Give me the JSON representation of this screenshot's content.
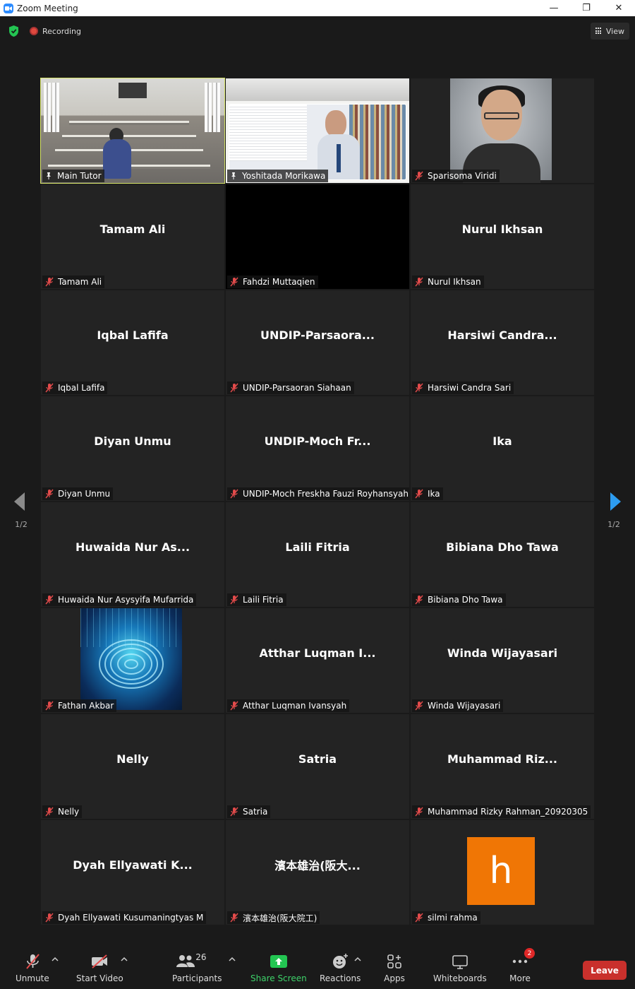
{
  "window": {
    "title": "Zoom Meeting",
    "controls": [
      "—",
      "❐",
      "✕"
    ]
  },
  "topbar": {
    "recording_label": "Recording",
    "view_label": "View"
  },
  "gallery": {
    "page_indicator_left": "1/2",
    "page_indicator_right": "1/2",
    "tiles": [
      {
        "label": "Main Tutor",
        "center": ""
      },
      {
        "label": "Yoshitada Morikawa",
        "center": ""
      },
      {
        "label": "Sparisoma Viridi",
        "center": ""
      },
      {
        "label": "Tamam Ali",
        "center": "Tamam Ali"
      },
      {
        "label": "Fahdzi Muttaqien",
        "center": ""
      },
      {
        "label": "Nurul Ikhsan",
        "center": "Nurul Ikhsan"
      },
      {
        "label": "Iqbal Lafifa",
        "center": "Iqbal Lafifa"
      },
      {
        "label": "UNDIP-Parsaoran Siahaan",
        "center": "UNDIP-Parsaora..."
      },
      {
        "label": "Harsiwi Candra Sari",
        "center": "Harsiwi Candra..."
      },
      {
        "label": "Diyan Unmu",
        "center": "Diyan Unmu"
      },
      {
        "label": "UNDIP-Moch Freskha Fauzi Royhansyah",
        "center": "UNDIP-Moch Fr..."
      },
      {
        "label": "Ika",
        "center": "Ika"
      },
      {
        "label": "Huwaida Nur Asysyifa Mufarrida",
        "center": "Huwaida Nur As..."
      },
      {
        "label": "Laili Fitria",
        "center": "Laili Fitria"
      },
      {
        "label": "Bibiana Dho Tawa",
        "center": "Bibiana Dho Tawa"
      },
      {
        "label": "Fathan Akbar",
        "center": ""
      },
      {
        "label": "Atthar Luqman Ivansyah",
        "center": "Atthar Luqman I..."
      },
      {
        "label": "Winda Wijayasari",
        "center": "Winda Wijayasari"
      },
      {
        "label": "Nelly",
        "center": "Nelly"
      },
      {
        "label": "Satria",
        "center": "Satria"
      },
      {
        "label": "Muhammad Rizky Rahman_20920305",
        "center": "Muhammad Riz..."
      },
      {
        "label": "Dyah Ellyawati Kusumaningtyas M",
        "center": "Dyah Ellyawati K..."
      },
      {
        "label": "濱本雄治(阪大院工)",
        "center": "濱本雄治(阪大..."
      },
      {
        "label": "silmi rahma",
        "center": "",
        "avatar_letter": "h"
      }
    ]
  },
  "toolbar": {
    "unmute": "Unmute",
    "start_video": "Start Video",
    "participants": "Participants",
    "participants_count": "26",
    "share_screen": "Share Screen",
    "reactions": "Reactions",
    "apps": "Apps",
    "whiteboards": "Whiteboards",
    "more": "More",
    "more_badge": "2",
    "leave": "Leave"
  },
  "colors": {
    "active_speaker_border": "#d8e66a",
    "share_green": "#23c552",
    "leave_red": "#c9302c",
    "avatar_orange": "#f07605",
    "nav_arrow_blue": "#2d9cf0"
  }
}
